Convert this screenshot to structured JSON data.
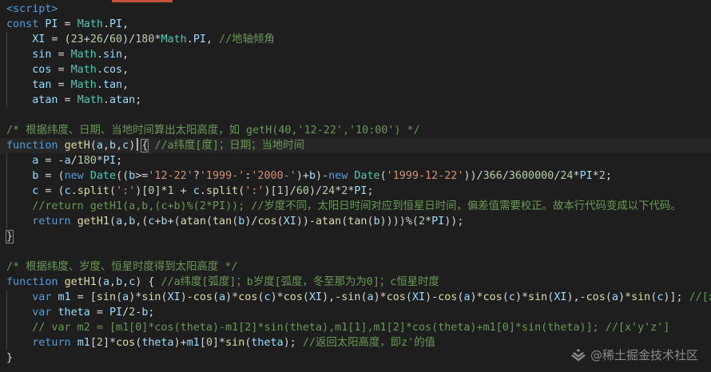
{
  "editor": {
    "lines": [
      [
        [
          "tag",
          "<script>"
        ]
      ],
      [
        [
          "kw",
          "const "
        ],
        [
          "var",
          "PI"
        ],
        [
          "op",
          " = "
        ],
        [
          "cls",
          "Math"
        ],
        [
          "op",
          "."
        ],
        [
          "var",
          "PI"
        ],
        [
          "op",
          ","
        ]
      ],
      [
        [
          "op",
          "    "
        ],
        [
          "var",
          "XI"
        ],
        [
          "op",
          " = ("
        ],
        [
          "num",
          "23"
        ],
        [
          "op",
          "+"
        ],
        [
          "num",
          "26"
        ],
        [
          "op",
          "/"
        ],
        [
          "num",
          "60"
        ],
        [
          "op",
          ")/"
        ],
        [
          "num",
          "180"
        ],
        [
          "op",
          "*"
        ],
        [
          "cls",
          "Math"
        ],
        [
          "op",
          "."
        ],
        [
          "var",
          "PI"
        ],
        [
          "op",
          ", "
        ],
        [
          "cm",
          "//地轴倾角"
        ]
      ],
      [
        [
          "op",
          "    "
        ],
        [
          "var",
          "sin"
        ],
        [
          "op",
          " = "
        ],
        [
          "cls",
          "Math"
        ],
        [
          "op",
          "."
        ],
        [
          "var",
          "sin"
        ],
        [
          "op",
          ","
        ]
      ],
      [
        [
          "op",
          "    "
        ],
        [
          "var",
          "cos"
        ],
        [
          "op",
          " = "
        ],
        [
          "cls",
          "Math"
        ],
        [
          "op",
          "."
        ],
        [
          "var",
          "cos"
        ],
        [
          "op",
          ","
        ]
      ],
      [
        [
          "op",
          "    "
        ],
        [
          "var",
          "tan"
        ],
        [
          "op",
          " = "
        ],
        [
          "cls",
          "Math"
        ],
        [
          "op",
          "."
        ],
        [
          "var",
          "tan"
        ],
        [
          "op",
          ","
        ]
      ],
      [
        [
          "op",
          "    "
        ],
        [
          "var",
          "atan"
        ],
        [
          "op",
          " = "
        ],
        [
          "cls",
          "Math"
        ],
        [
          "op",
          "."
        ],
        [
          "var",
          "atan"
        ],
        [
          "op",
          ";"
        ]
      ],
      [],
      [
        [
          "cm",
          "/* 根据纬度、日期、当地时间算出太阳高度，如 getH(40,'12-22','10:00') */"
        ]
      ],
      [
        [
          "kw",
          "function "
        ],
        [
          "fn",
          "getH"
        ],
        [
          "op",
          "("
        ],
        [
          "var",
          "a"
        ],
        [
          "op",
          ","
        ],
        [
          "var",
          "b"
        ],
        [
          "op",
          ","
        ],
        [
          "var",
          "c"
        ],
        [
          "op",
          ") "
        ],
        [
          "brm",
          "{"
        ],
        [
          "op",
          " "
        ],
        [
          "cm",
          "//a纬度[度]；日期；当地时间"
        ]
      ],
      [
        [
          "op",
          "    "
        ],
        [
          "var",
          "a"
        ],
        [
          "op",
          " = -"
        ],
        [
          "var",
          "a"
        ],
        [
          "op",
          "/"
        ],
        [
          "num",
          "180"
        ],
        [
          "op",
          "*"
        ],
        [
          "var",
          "PI"
        ],
        [
          "op",
          ";"
        ]
      ],
      [
        [
          "op",
          "    "
        ],
        [
          "var",
          "b"
        ],
        [
          "op",
          " = ("
        ],
        [
          "kw",
          "new "
        ],
        [
          "cls",
          "Date"
        ],
        [
          "op",
          "(("
        ],
        [
          "var",
          "b"
        ],
        [
          "op",
          ">="
        ],
        [
          "str",
          "'12-22'"
        ],
        [
          "op",
          "?"
        ],
        [
          "str",
          "'1999-'"
        ],
        [
          "op",
          ":"
        ],
        [
          "str",
          "'2000-'"
        ],
        [
          "op",
          ")+"
        ],
        [
          "var",
          "b"
        ],
        [
          "op",
          ")-"
        ],
        [
          "kw",
          "new "
        ],
        [
          "cls",
          "Date"
        ],
        [
          "op",
          "("
        ],
        [
          "str",
          "'1999-12-22'"
        ],
        [
          "op",
          "))/"
        ],
        [
          "num",
          "366"
        ],
        [
          "op",
          "/"
        ],
        [
          "num",
          "3600000"
        ],
        [
          "op",
          "/"
        ],
        [
          "num",
          "24"
        ],
        [
          "op",
          "*"
        ],
        [
          "var",
          "PI"
        ],
        [
          "op",
          "*"
        ],
        [
          "num",
          "2"
        ],
        [
          "op",
          ";"
        ]
      ],
      [
        [
          "op",
          "    "
        ],
        [
          "var",
          "c"
        ],
        [
          "op",
          " = ("
        ],
        [
          "var",
          "c"
        ],
        [
          "op",
          "."
        ],
        [
          "fn",
          "split"
        ],
        [
          "op",
          "("
        ],
        [
          "str",
          "':'"
        ],
        [
          "op",
          ")["
        ],
        [
          "num",
          "0"
        ],
        [
          "op",
          "]*"
        ],
        [
          "num",
          "1"
        ],
        [
          "op",
          " + "
        ],
        [
          "var",
          "c"
        ],
        [
          "op",
          "."
        ],
        [
          "fn",
          "split"
        ],
        [
          "op",
          "("
        ],
        [
          "str",
          "':'"
        ],
        [
          "op",
          ")["
        ],
        [
          "num",
          "1"
        ],
        [
          "op",
          "]/"
        ],
        [
          "num",
          "60"
        ],
        [
          "op",
          ")/"
        ],
        [
          "num",
          "24"
        ],
        [
          "op",
          "*"
        ],
        [
          "num",
          "2"
        ],
        [
          "op",
          "*"
        ],
        [
          "var",
          "PI"
        ],
        [
          "op",
          ";"
        ]
      ],
      [
        [
          "op",
          "    "
        ],
        [
          "cm",
          "//return getH1(a,b,(c+b)%(2*PI)); //岁度不同，太阳日时间对应到恒星日时间，偏差值需要校正。故本行代码变成以下代码。"
        ]
      ],
      [
        [
          "op",
          "    "
        ],
        [
          "kw",
          "return "
        ],
        [
          "fn",
          "getH1"
        ],
        [
          "op",
          "("
        ],
        [
          "var",
          "a"
        ],
        [
          "op",
          ","
        ],
        [
          "var",
          "b"
        ],
        [
          "op",
          ",("
        ],
        [
          "var",
          "c"
        ],
        [
          "op",
          "+"
        ],
        [
          "var",
          "b"
        ],
        [
          "op",
          "+("
        ],
        [
          "fn",
          "atan"
        ],
        [
          "op",
          "("
        ],
        [
          "fn",
          "tan"
        ],
        [
          "op",
          "("
        ],
        [
          "var",
          "b"
        ],
        [
          "op",
          ")/"
        ],
        [
          "fn",
          "cos"
        ],
        [
          "op",
          "("
        ],
        [
          "var",
          "XI"
        ],
        [
          "op",
          "))-"
        ],
        [
          "fn",
          "atan"
        ],
        [
          "op",
          "("
        ],
        [
          "fn",
          "tan"
        ],
        [
          "op",
          "("
        ],
        [
          "var",
          "b"
        ],
        [
          "op",
          "))))%("
        ],
        [
          "num",
          "2"
        ],
        [
          "op",
          "*"
        ],
        [
          "var",
          "PI"
        ],
        [
          "op",
          "));"
        ]
      ],
      [
        [
          "brm",
          "}"
        ]
      ],
      [],
      [
        [
          "cm",
          "/* 根据纬度、岁度、恒星时度得到太阳高度 */"
        ]
      ],
      [
        [
          "kw",
          "function "
        ],
        [
          "fn",
          "getH1"
        ],
        [
          "op",
          "("
        ],
        [
          "var",
          "a"
        ],
        [
          "op",
          ","
        ],
        [
          "var",
          "b"
        ],
        [
          "op",
          ","
        ],
        [
          "var",
          "c"
        ],
        [
          "op",
          ") { "
        ],
        [
          "cm",
          "//a纬度[弧度]；b岁度[弧度，冬至那为为0]；c恒星时度"
        ]
      ],
      [
        [
          "op",
          "    "
        ],
        [
          "kw",
          "var "
        ],
        [
          "var",
          "m1"
        ],
        [
          "op",
          " = ["
        ],
        [
          "fn",
          "sin"
        ],
        [
          "op",
          "("
        ],
        [
          "var",
          "a"
        ],
        [
          "op",
          ")*"
        ],
        [
          "fn",
          "sin"
        ],
        [
          "op",
          "("
        ],
        [
          "var",
          "XI"
        ],
        [
          "op",
          ")-"
        ],
        [
          "fn",
          "cos"
        ],
        [
          "op",
          "("
        ],
        [
          "var",
          "a"
        ],
        [
          "op",
          ")*"
        ],
        [
          "fn",
          "cos"
        ],
        [
          "op",
          "("
        ],
        [
          "var",
          "c"
        ],
        [
          "op",
          ")*"
        ],
        [
          "fn",
          "cos"
        ],
        [
          "op",
          "("
        ],
        [
          "var",
          "XI"
        ],
        [
          "op",
          "),-"
        ],
        [
          "fn",
          "sin"
        ],
        [
          "op",
          "("
        ],
        [
          "var",
          "a"
        ],
        [
          "op",
          ")*"
        ],
        [
          "fn",
          "cos"
        ],
        [
          "op",
          "("
        ],
        [
          "var",
          "XI"
        ],
        [
          "op",
          ")-"
        ],
        [
          "fn",
          "cos"
        ],
        [
          "op",
          "("
        ],
        [
          "var",
          "a"
        ],
        [
          "op",
          ")*"
        ],
        [
          "fn",
          "cos"
        ],
        [
          "op",
          "("
        ],
        [
          "var",
          "c"
        ],
        [
          "op",
          ")*"
        ],
        [
          "fn",
          "sin"
        ],
        [
          "op",
          "("
        ],
        [
          "var",
          "XI"
        ],
        [
          "op",
          "),-"
        ],
        [
          "fn",
          "cos"
        ],
        [
          "op",
          "("
        ],
        [
          "var",
          "a"
        ],
        [
          "op",
          ")*"
        ],
        [
          "fn",
          "sin"
        ],
        [
          "op",
          "("
        ],
        [
          "var",
          "c"
        ],
        [
          "op",
          ")]; "
        ],
        [
          "cm",
          "//[xyz]"
        ]
      ],
      [
        [
          "op",
          "    "
        ],
        [
          "kw",
          "var "
        ],
        [
          "var",
          "theta"
        ],
        [
          "op",
          " = "
        ],
        [
          "var",
          "PI"
        ],
        [
          "op",
          "/"
        ],
        [
          "num",
          "2"
        ],
        [
          "op",
          "-"
        ],
        [
          "var",
          "b"
        ],
        [
          "op",
          ";"
        ]
      ],
      [
        [
          "op",
          "    "
        ],
        [
          "cm",
          "// var m2 = [m1[0]*cos(theta)-m1[2]*sin(theta),m1[1],m1[2]*cos(theta)+m1[0]*sin(theta)]; //[x'y'z']"
        ]
      ],
      [
        [
          "op",
          "    "
        ],
        [
          "kw",
          "return "
        ],
        [
          "var",
          "m1"
        ],
        [
          "op",
          "["
        ],
        [
          "num",
          "2"
        ],
        [
          "op",
          "]*"
        ],
        [
          "fn",
          "cos"
        ],
        [
          "op",
          "("
        ],
        [
          "var",
          "theta"
        ],
        [
          "op",
          ")+"
        ],
        [
          "var",
          "m1"
        ],
        [
          "op",
          "["
        ],
        [
          "num",
          "0"
        ],
        [
          "op",
          "]*"
        ],
        [
          "fn",
          "sin"
        ],
        [
          "op",
          "("
        ],
        [
          "var",
          "theta"
        ],
        [
          "op",
          "); "
        ],
        [
          "cm",
          "//返回太阳高度，即z'的值"
        ]
      ],
      [
        [
          "op",
          "}"
        ]
      ]
    ]
  },
  "watermark": {
    "text": "@稀土掘金技术社区",
    "logo_icon": "juejin-logo-icon"
  },
  "colors": {
    "background": "#1e1e1e",
    "keyword": "#569cd6",
    "function": "#dcdcaa",
    "variable": "#9cdcfe",
    "class": "#4ec9b0",
    "number": "#b5cea8",
    "string": "#ce9178",
    "comment": "#6a9955",
    "top_accent": "#c5513a"
  }
}
